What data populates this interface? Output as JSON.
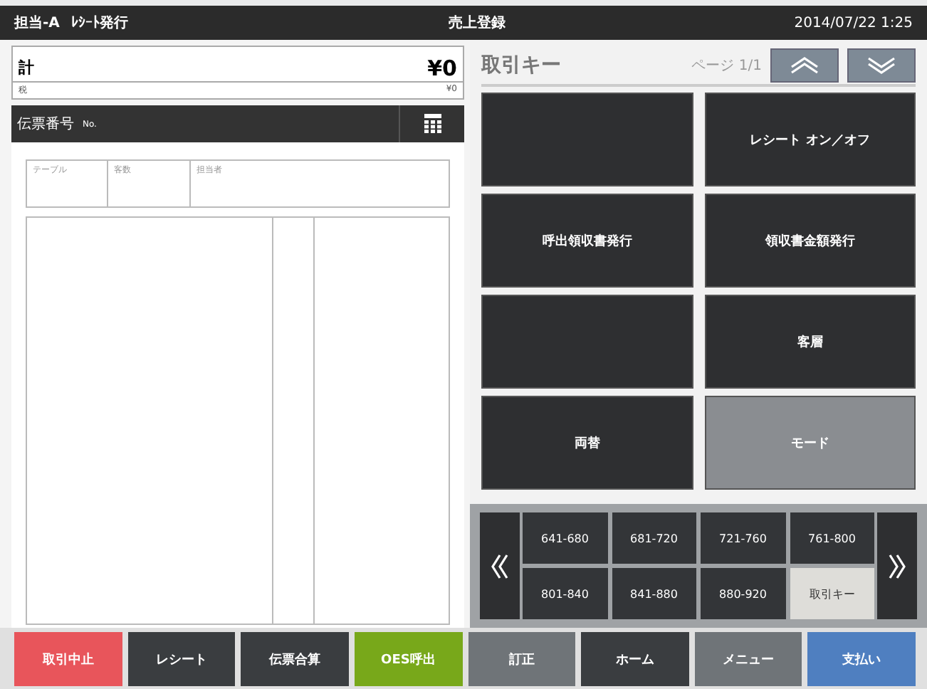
{
  "header": {
    "staff": "担当-A",
    "mode": "ﾚｼｰﾄ発行",
    "title": "売上登録",
    "datetime": "2014/07/22 1:25"
  },
  "total": {
    "label": "計",
    "amount": "¥0",
    "tax_label": "税",
    "tax_amount": "¥0"
  },
  "slip": {
    "label": "伝票番号",
    "no_label": "No."
  },
  "info_columns": [
    "テーブル",
    "客数",
    "担当者"
  ],
  "keys_panel": {
    "title": "取引キー",
    "page": "ページ 1/1"
  },
  "keys": [
    {
      "kind": "blank"
    },
    {
      "kind": "action",
      "label": "レシート オン／オフ"
    },
    {
      "kind": "action",
      "label": "呼出領収書発行"
    },
    {
      "kind": "action",
      "label": "領収書金額発行"
    },
    {
      "kind": "blank"
    },
    {
      "kind": "action",
      "label": "客層"
    },
    {
      "kind": "action",
      "label": "両替"
    },
    {
      "kind": "mode",
      "label": "モード"
    }
  ],
  "ranges": [
    {
      "label": "641-680",
      "selected": false
    },
    {
      "label": "681-720",
      "selected": false
    },
    {
      "label": "721-760",
      "selected": false
    },
    {
      "label": "761-800",
      "selected": false
    },
    {
      "label": "801-840",
      "selected": false
    },
    {
      "label": "841-880",
      "selected": false
    },
    {
      "label": "880-920",
      "selected": false
    },
    {
      "label": "取引キー",
      "selected": true
    }
  ],
  "bottom_buttons": [
    {
      "label": "取引中止",
      "color": "#e8555b"
    },
    {
      "label": "レシート",
      "color": "#3a3d40"
    },
    {
      "label": "伝票合算",
      "color": "#3a3d40"
    },
    {
      "label": "OES呼出",
      "color": "#78a81a"
    },
    {
      "label": "訂正",
      "color": "#6f7478"
    },
    {
      "label": "ホーム",
      "color": "#3a3d40"
    },
    {
      "label": "メニュー",
      "color": "#6f7478"
    },
    {
      "label": "支払い",
      "color": "#4f7fc0"
    }
  ]
}
